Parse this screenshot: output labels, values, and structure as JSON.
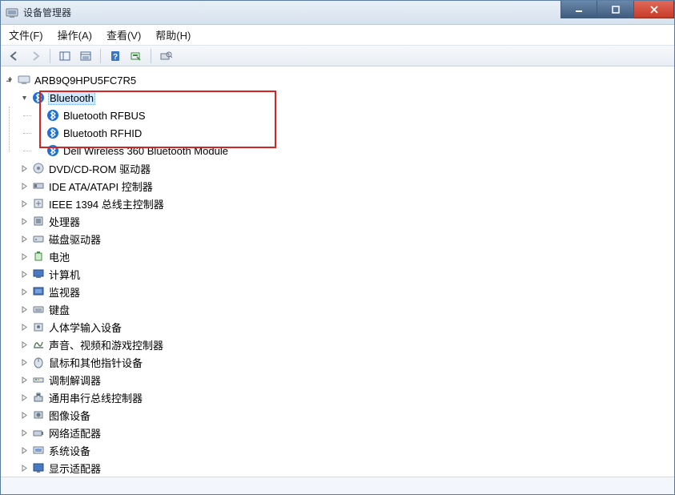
{
  "window": {
    "title": "设备管理器"
  },
  "menu": {
    "file": "文件(F)",
    "action": "操作(A)",
    "view": "查看(V)",
    "help": "帮助(H)"
  },
  "tree": {
    "root": "ARB9Q9HPU5FC7R5",
    "bluetooth": {
      "label": "Bluetooth",
      "children": [
        "Bluetooth RFBUS",
        "Bluetooth RFHID",
        "Dell Wireless 360 Bluetooth Module"
      ]
    },
    "categories": [
      "DVD/CD-ROM 驱动器",
      "IDE ATA/ATAPI 控制器",
      "IEEE 1394 总线主控制器",
      "处理器",
      "磁盘驱动器",
      "电池",
      "计算机",
      "监视器",
      "键盘",
      "人体学输入设备",
      "声音、视频和游戏控制器",
      "鼠标和其他指针设备",
      "调制解调器",
      "通用串行总线控制器",
      "图像设备",
      "网络适配器",
      "系统设备",
      "显示适配器"
    ]
  }
}
